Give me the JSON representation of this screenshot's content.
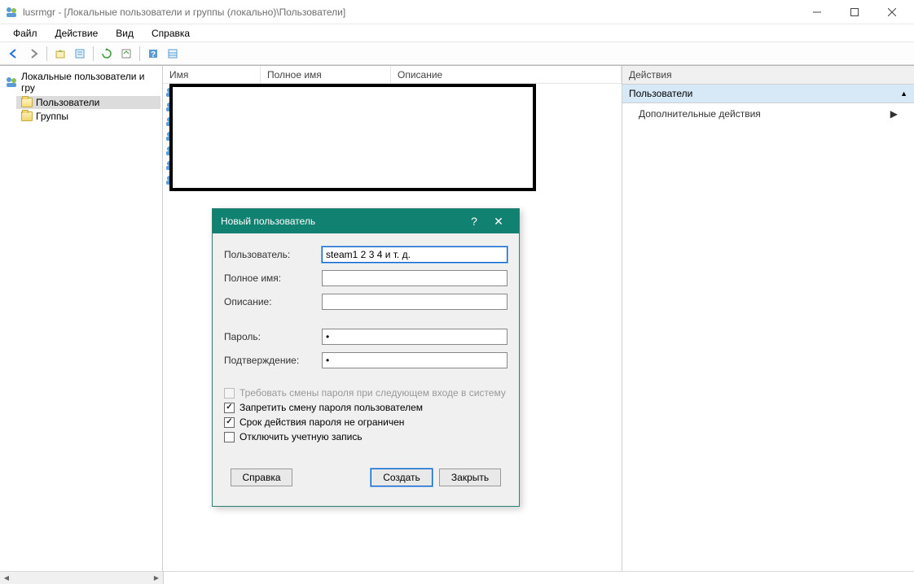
{
  "window": {
    "title": "lusrmgr - [Локальные пользователи и группы (локально)\\Пользователи]"
  },
  "menu": {
    "file": "Файл",
    "action": "Действие",
    "view": "Вид",
    "help": "Справка"
  },
  "tree": {
    "root": "Локальные пользователи и гру",
    "users": "Пользователи",
    "groups": "Группы"
  },
  "columns": {
    "name": "Имя",
    "fullname": "Полное имя",
    "description": "Описание"
  },
  "actions": {
    "header": "Действия",
    "section": "Пользователи",
    "more": "Дополнительные действия"
  },
  "dialog": {
    "title": "Новый пользователь",
    "user_label": "Пользователь:",
    "user_value": "steam1 2 3 4 и т. д.",
    "fullname_label": "Полное имя:",
    "fullname_value": "",
    "desc_label": "Описание:",
    "desc_value": "",
    "password_label": "Пароль:",
    "password_value": "*",
    "confirm_label": "Подтверждение:",
    "confirm_value": "*",
    "chk_must_change": "Требовать смены пароля при следующем входе в систему",
    "chk_cannot_change": "Запретить смену пароля пользователем",
    "chk_never_expires": "Срок действия пароля не ограничен",
    "chk_disabled": "Отключить учетную запись",
    "btn_help": "Справка",
    "btn_create": "Создать",
    "btn_close": "Закрыть"
  }
}
